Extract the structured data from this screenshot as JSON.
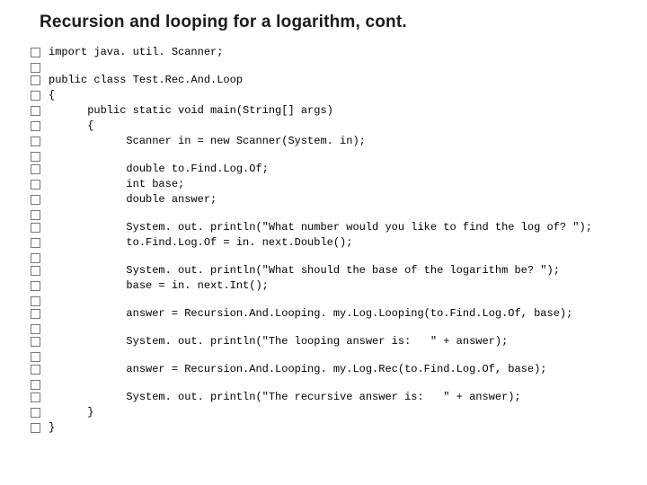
{
  "title": "Recursion and looping for a logarithm, cont.",
  "lines": [
    "import java. util. Scanner;",
    "",
    "public class Test.Rec.And.Loop",
    "{",
    "      public static void main(String[] args)",
    "      {",
    "            Scanner in = new Scanner(System. in);",
    "",
    "            double to.Find.Log.Of;",
    "            int base;",
    "            double answer;",
    "",
    "            System. out. println(\"What number would you like to find the log of? \");",
    "            to.Find.Log.Of = in. next.Double();",
    "",
    "            System. out. println(\"What should the base of the logarithm be? \");",
    "            base = in. next.Int();",
    "",
    "            answer = Recursion.And.Looping. my.Log.Looping(to.Find.Log.Of, base);",
    "",
    "            System. out. println(\"The looping answer is:   \" + answer);",
    "",
    "            answer = Recursion.And.Looping. my.Log.Rec(to.Find.Log.Of, base);",
    "",
    "            System. out. println(\"The recursive answer is:   \" + answer);",
    "      }",
    "}"
  ]
}
